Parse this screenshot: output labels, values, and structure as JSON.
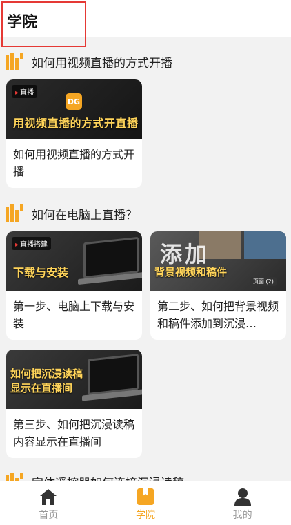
{
  "header": {
    "title": "学院"
  },
  "sections": [
    {
      "title": "如何用视频直播的方式开播",
      "cards": [
        {
          "tag": "直播",
          "thumb_caption": "用视频直播的方式开直播",
          "logo_text": "DG",
          "text": "如何用视频直播的方式开播"
        }
      ]
    },
    {
      "title": "如何在电脑上直播？",
      "cards": [
        {
          "tag": "直播搭建",
          "thumb_caption": "下载与安装",
          "text": "第一步、电脑上下载与安装"
        },
        {
          "thumb_big": "添加",
          "thumb_caption": "背景视频和稿件",
          "thumb_badge": "页面 (2)",
          "text": "第二步、如何把背景视频和稿件添加到沉浸…"
        },
        {
          "thumb_caption_1": "如何把沉浸读稿",
          "thumb_caption_2": "显示在直播间",
          "text": "第三步、如何把沉浸读稿内容显示在直播间"
        }
      ]
    },
    {
      "title": "字体遥控器如何连接沉浸读稿"
    }
  ],
  "tabbar": {
    "items": [
      {
        "label": "首页",
        "icon": "home-icon",
        "active": false
      },
      {
        "label": "学院",
        "icon": "book-icon",
        "active": true
      },
      {
        "label": "我的",
        "icon": "user-icon",
        "active": false
      }
    ],
    "active_color": "#f5a623",
    "inactive_color": "#999999"
  }
}
